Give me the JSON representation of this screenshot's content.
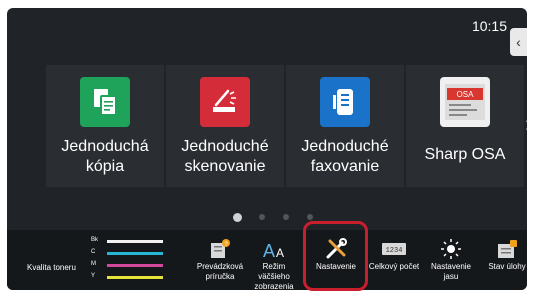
{
  "status": {
    "time": "10:15"
  },
  "side_tab_icon": "chevron-left-icon",
  "tiles": [
    {
      "line1": "Jednoduchá",
      "line2": "kópia",
      "icon": "copy-icon",
      "color": "#1fa35a"
    },
    {
      "line1": "Jednoduché",
      "line2": "skenovanie",
      "icon": "scan-icon",
      "color": "#d52c3a"
    },
    {
      "line1": "Jednoduché",
      "line2": "faxovanie",
      "icon": "fax-icon",
      "color": "#1a73c9"
    },
    {
      "line1": "Sharp OSA",
      "line2": "",
      "icon": "sharp-osa-icon",
      "color": "#f0f0f0"
    }
  ],
  "toner": {
    "label": "Kvalita toneru",
    "channels": [
      {
        "key": "Bk",
        "color": "#f2f2f2"
      },
      {
        "key": "C",
        "color": "#28b6d7"
      },
      {
        "key": "M",
        "color": "#d2489a"
      },
      {
        "key": "Y",
        "color": "#e6e23a"
      }
    ]
  },
  "functions": [
    {
      "label": "Prevádzková príručka",
      "icon": "manual-icon"
    },
    {
      "label": "Režim väčšieho zobrazenia",
      "icon": "large-text-icon"
    },
    {
      "label": "Nastavenie",
      "icon": "settings-wrench-icon"
    },
    {
      "label": "Celkový počet",
      "icon": "counter-icon"
    },
    {
      "label": "Nastavenie jasu",
      "icon": "brightness-icon"
    },
    {
      "label": "Stav úlohy",
      "icon": "job-status-icon"
    }
  ]
}
